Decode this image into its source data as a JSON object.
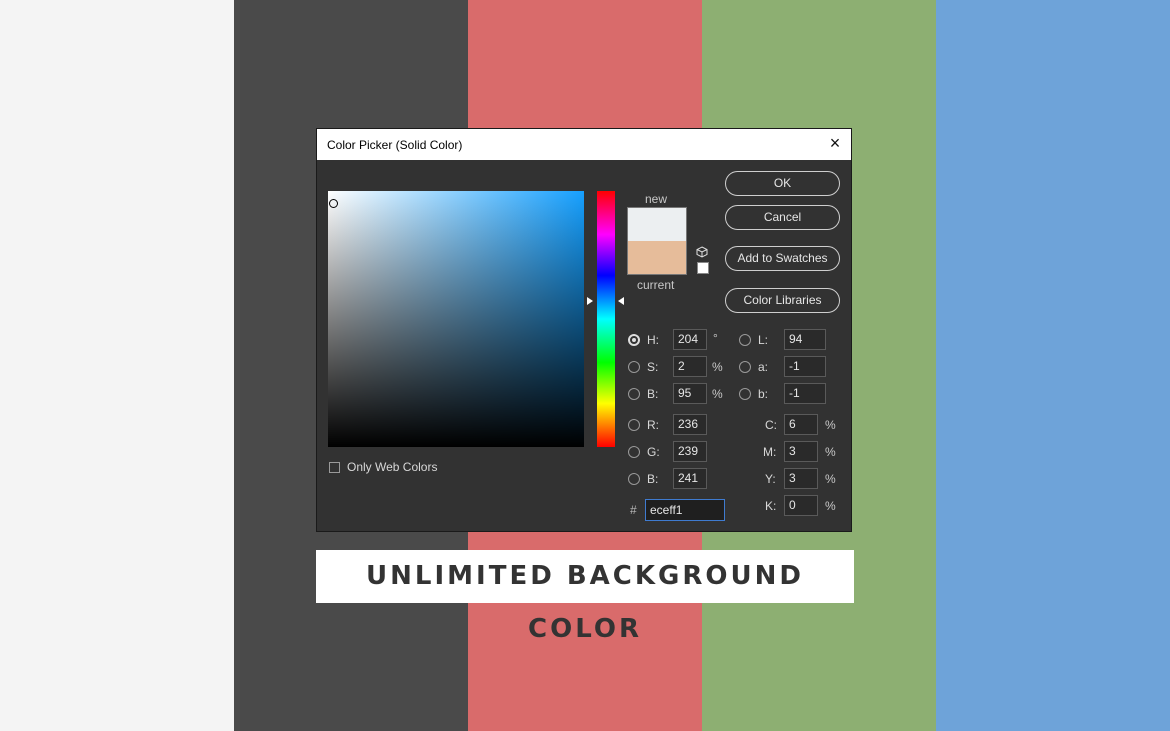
{
  "background": {
    "stripe_colors": [
      "#f4f4f4",
      "#4a4a4a",
      "#d96b6b",
      "#8daf72",
      "#6ea3d9"
    ]
  },
  "dialog": {
    "title": "Color Picker (Solid Color)",
    "close_icon": "close-icon",
    "labels": {
      "new": "new",
      "current": "current"
    },
    "colors": {
      "new": "#eceff1",
      "current": "#e6bc9a"
    },
    "buttons": {
      "ok": "OK",
      "cancel": "Cancel",
      "add_to_swatches": "Add to Swatches",
      "color_libraries": "Color Libraries"
    },
    "hsb": {
      "h_label": "H:",
      "h_value": "204",
      "h_unit": "°",
      "s_label": "S:",
      "s_value": "2",
      "s_unit": "%",
      "b_label": "B:",
      "b_value": "95",
      "b_unit": "%"
    },
    "lab": {
      "l_label": "L:",
      "l_value": "94",
      "a_label": "a:",
      "a_value": "-1",
      "b_label": "b:",
      "b_value": "-1"
    },
    "rgb": {
      "r_label": "R:",
      "r_value": "236",
      "g_label": "G:",
      "g_value": "239",
      "b_label": "B:",
      "b_value": "241"
    },
    "cmyk": {
      "c_label": "C:",
      "c_value": "6",
      "m_label": "M:",
      "m_value": "3",
      "y_label": "Y:",
      "y_value": "3",
      "k_label": "K:",
      "k_value": "0",
      "unit": "%"
    },
    "hex": {
      "label": "#",
      "value": "eceff1"
    },
    "only_web_colors": "Only Web Colors"
  },
  "banner": {
    "text": "UNLIMITED BACKGROUND COLOR"
  }
}
